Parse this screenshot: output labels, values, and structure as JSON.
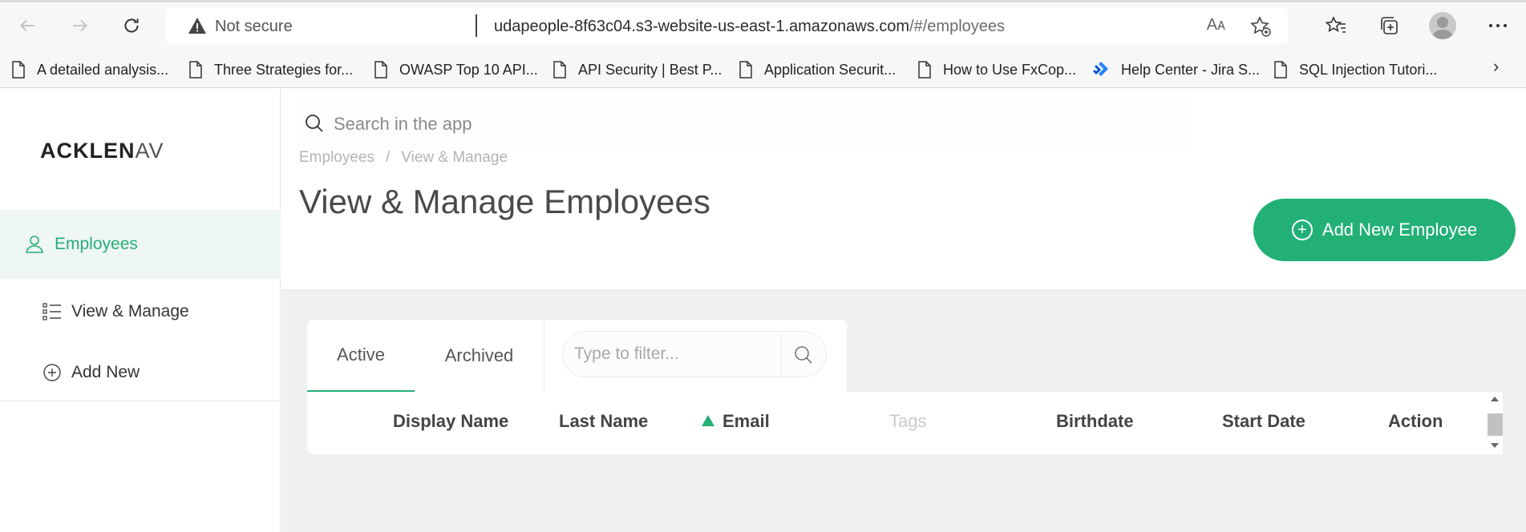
{
  "browser": {
    "security_label": "Not secure",
    "url_host": "udapeople-8f63c04.s3-website-us-east-1.amazonaws.com",
    "url_path": "/#/employees",
    "read_aloud_label": "Aᴀ"
  },
  "bookmarks": [
    {
      "label": "A detailed analysis..."
    },
    {
      "label": "Three Strategies for..."
    },
    {
      "label": "OWASP Top 10 API..."
    },
    {
      "label": "API Security | Best P..."
    },
    {
      "label": "Application Securit..."
    },
    {
      "label": "How to Use FxCop..."
    },
    {
      "label": "Help Center - Jira S..."
    },
    {
      "label": "SQL Injection Tutori..."
    }
  ],
  "sidebar": {
    "logo_bold": "ACKLEN",
    "logo_thin": "AV",
    "items": [
      {
        "label": "Employees",
        "icon": "user-icon"
      },
      {
        "label": "View & Manage",
        "icon": "list-icon"
      },
      {
        "label": "Add New",
        "icon": "plus-circle-icon"
      }
    ]
  },
  "search": {
    "placeholder": "Search in the app"
  },
  "breadcrumb": {
    "items": [
      "Employees",
      "View & Manage"
    ],
    "separator": "/"
  },
  "page": {
    "title": "View & Manage Employees",
    "add_button": "Add New Employee"
  },
  "tabs": [
    {
      "label": "Active",
      "active": true
    },
    {
      "label": "Archived",
      "active": false
    }
  ],
  "filter": {
    "placeholder": "Type to filter..."
  },
  "table": {
    "columns": [
      {
        "label": "Display Name"
      },
      {
        "label": "Last Name"
      },
      {
        "label": "Email",
        "sorted": "asc"
      },
      {
        "label": "Tags"
      },
      {
        "label": "Birthdate"
      },
      {
        "label": "Start Date"
      },
      {
        "label": "Action"
      }
    ]
  },
  "colors": {
    "accent": "#22b077",
    "sidebar_active_bg": "#eef7f4",
    "main_bg": "#eef0f1"
  }
}
